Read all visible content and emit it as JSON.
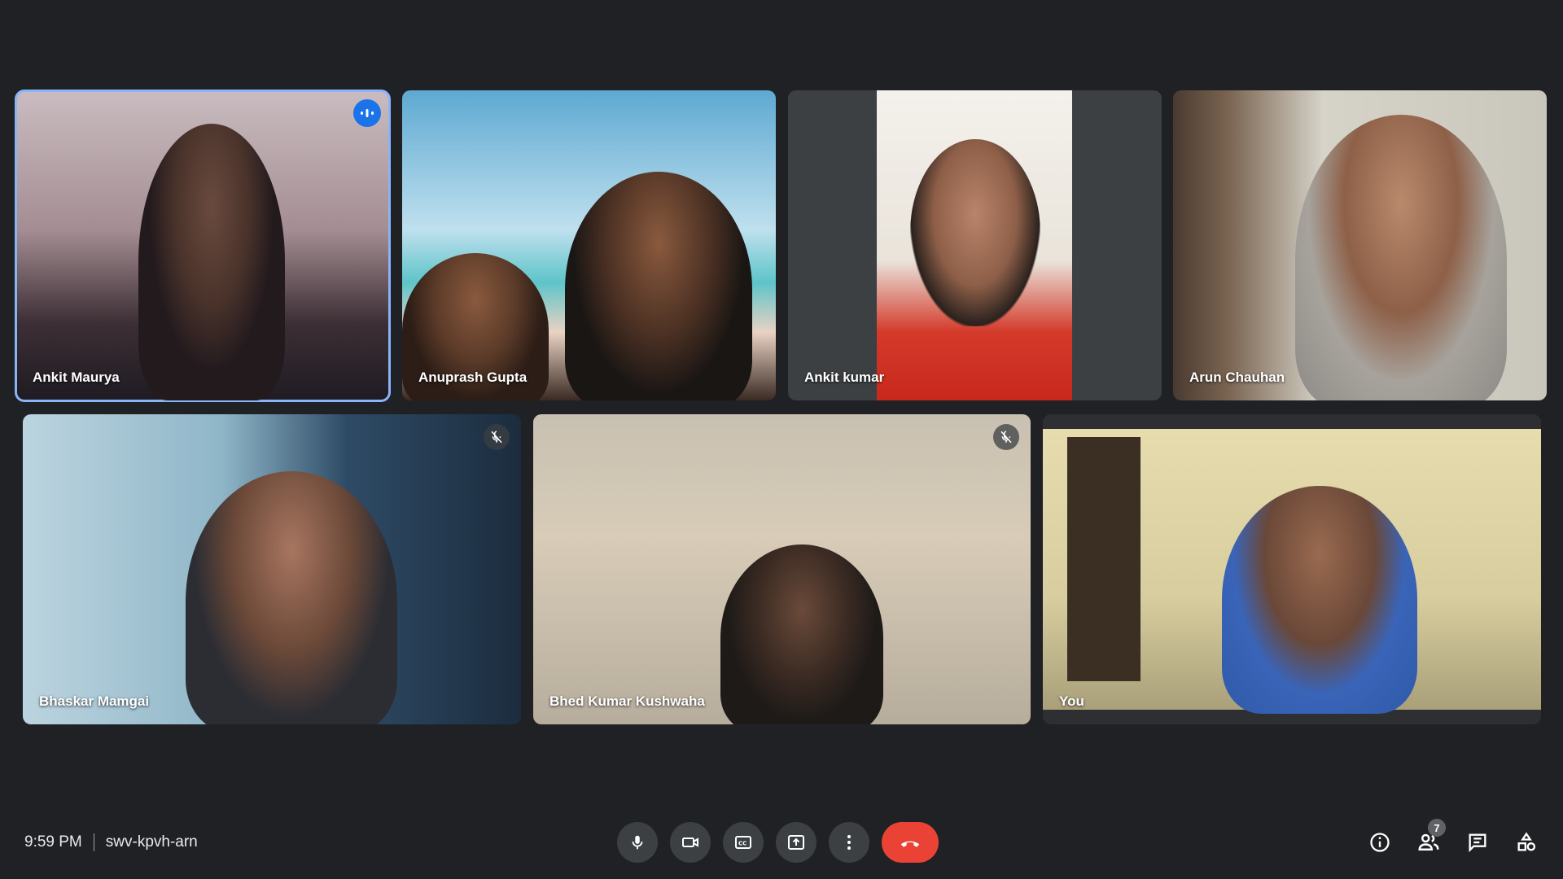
{
  "participants": [
    {
      "name": "Ankit Maurya",
      "speaking": true,
      "muted": false
    },
    {
      "name": "Anuprash Gupta",
      "speaking": false,
      "muted": false
    },
    {
      "name": "Ankit kumar",
      "speaking": false,
      "muted": false
    },
    {
      "name": "Arun Chauhan",
      "speaking": false,
      "muted": false
    },
    {
      "name": "Bhaskar Mamgai",
      "speaking": false,
      "muted": true
    },
    {
      "name": "Bhed Kumar Kushwaha",
      "speaking": false,
      "muted": true
    },
    {
      "name": "You",
      "speaking": false,
      "muted": false
    }
  ],
  "meeting": {
    "time": "9:59 PM",
    "code": "swv-kpvh-arn"
  },
  "people_count": "7",
  "colors": {
    "background": "#202124",
    "control": "#3c4043",
    "end_call": "#ea4335",
    "active_outline": "#8ab4f8",
    "speaking_badge": "#1a73e8"
  },
  "icons": {
    "mic": "mic-icon",
    "camera": "camera-icon",
    "captions": "captions-icon",
    "present": "present-icon",
    "more": "more-vert-icon",
    "end": "end-call-icon",
    "info": "info-icon",
    "people": "people-icon",
    "chat": "chat-icon",
    "activities": "activities-icon"
  }
}
